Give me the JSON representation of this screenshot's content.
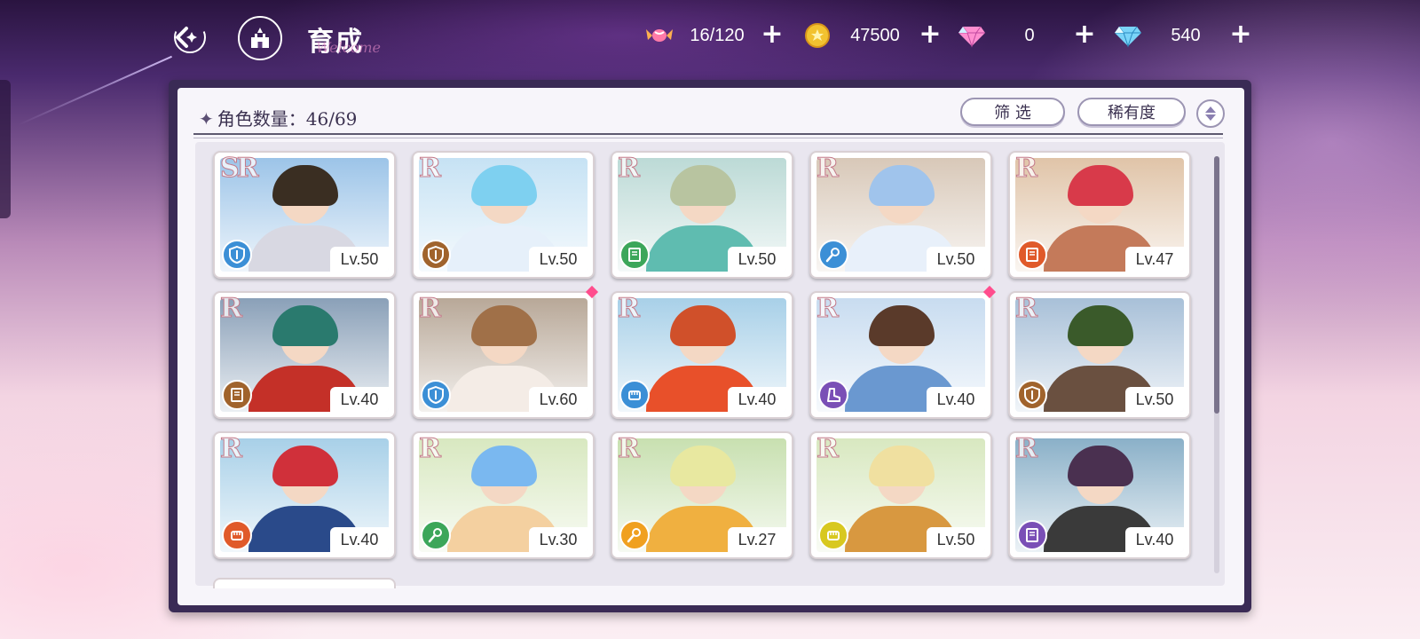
{
  "header": {
    "title": "育成",
    "subtitle_script": "Welcome",
    "currencies": [
      {
        "icon": "candy-icon",
        "value": "16/120"
      },
      {
        "icon": "gold-coin-icon",
        "value": "47500"
      },
      {
        "icon": "pink-diamond-icon",
        "value": "0"
      },
      {
        "icon": "blue-diamond-icon",
        "value": "540"
      }
    ],
    "plus": "+"
  },
  "panel": {
    "count_prefix": "✦",
    "count_label": "角色数量：46/69",
    "filter_label": "筛 选",
    "rarity_label": "稀有度"
  },
  "colors": {
    "class_blue": "#3b8fd6",
    "class_brown": "#a0632c",
    "class_green": "#3ca65a",
    "class_orange_red": "#e05a2a",
    "class_purple": "#7a4fb6",
    "class_orange": "#f0a020",
    "class_yellow": "#d8c820"
  },
  "cards": [
    {
      "rarity": "SR",
      "level": "Lv.50",
      "class_icon": "shield-icon",
      "class_color": "#3b8fd6",
      "notif": false,
      "hair": "#3a2e22",
      "body": "#d8d8e2",
      "sky": "#9cc4e8"
    },
    {
      "rarity": "R",
      "level": "Lv.50",
      "class_icon": "shield-icon",
      "class_color": "#a0632c",
      "notif": false,
      "hair": "#7ed0f0",
      "body": "#e6f0fa",
      "sky": "#c6e2f4"
    },
    {
      "rarity": "R",
      "level": "Lv.50",
      "class_icon": "book-icon",
      "class_color": "#3ca65a",
      "notif": false,
      "hair": "#b8c4a0",
      "body": "#5fbcb0",
      "sky": "#bcdad6"
    },
    {
      "rarity": "R",
      "level": "Lv.50",
      "class_icon": "staff-icon",
      "class_color": "#3b8fd6",
      "notif": false,
      "hair": "#a0c4ec",
      "body": "#e8f0fa",
      "sky": "#d8c8b8"
    },
    {
      "rarity": "R",
      "level": "Lv.47",
      "class_icon": "book-icon",
      "class_color": "#e05a2a",
      "notif": false,
      "hair": "#d83a4a",
      "body": "#c47a5a",
      "sky": "#e0c4a8"
    },
    {
      "rarity": "R",
      "level": "Lv.40",
      "class_icon": "book-icon",
      "class_color": "#a0632c",
      "notif": false,
      "hair": "#2a7a6e",
      "body": "#c43028",
      "sky": "#8aa0b8"
    },
    {
      "rarity": "R",
      "level": "Lv.60",
      "class_icon": "shield-icon",
      "class_color": "#3b8fd6",
      "notif": true,
      "hair": "#a07048",
      "body": "#f4ece6",
      "sky": "#b8a898"
    },
    {
      "rarity": "R",
      "level": "Lv.40",
      "class_icon": "fist-icon",
      "class_color": "#3b8fd6",
      "notif": false,
      "hair": "#d0502a",
      "body": "#e8502a",
      "sky": "#a8d0e8"
    },
    {
      "rarity": "R",
      "level": "Lv.40",
      "class_icon": "boot-icon",
      "class_color": "#7a4fb6",
      "notif": true,
      "hair": "#5a3a2a",
      "body": "#6a98d0",
      "sky": "#c8dcf0"
    },
    {
      "rarity": "R",
      "level": "Lv.50",
      "class_icon": "shield-icon",
      "class_color": "#a0632c",
      "notif": false,
      "hair": "#3a5a2a",
      "body": "#6a5040",
      "sky": "#a8c0d8"
    },
    {
      "rarity": "R",
      "level": "Lv.40",
      "class_icon": "fist-icon",
      "class_color": "#e05a2a",
      "notif": false,
      "hair": "#d0303a",
      "body": "#2a4a8a",
      "sky": "#a8d0e8"
    },
    {
      "rarity": "R",
      "level": "Lv.30",
      "class_icon": "staff-icon",
      "class_color": "#3ca65a",
      "notif": false,
      "hair": "#7ab8f0",
      "body": "#f4d0a0",
      "sky": "#d8e8c0"
    },
    {
      "rarity": "R",
      "level": "Lv.27",
      "class_icon": "staff-icon",
      "class_color": "#f0a020",
      "notif": false,
      "hair": "#e8e8a0",
      "body": "#f0b040",
      "sky": "#c8e0b0"
    },
    {
      "rarity": "R",
      "level": "Lv.50",
      "class_icon": "fist-icon",
      "class_color": "#d8c820",
      "notif": false,
      "hair": "#f0e0a0",
      "body": "#d89840",
      "sky": "#d8e8c0"
    },
    {
      "rarity": "R",
      "level": "Lv.40",
      "class_icon": "book-icon",
      "class_color": "#7a4fb6",
      "notif": false,
      "hair": "#4a3050",
      "body": "#3a3a3a",
      "sky": "#8ab0c8"
    }
  ]
}
